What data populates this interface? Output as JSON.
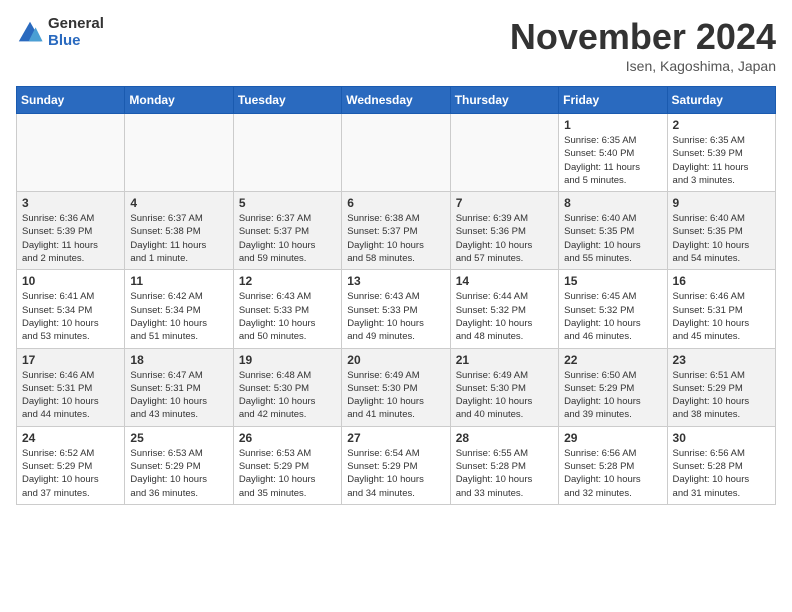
{
  "logo": {
    "general": "General",
    "blue": "Blue"
  },
  "title": "November 2024",
  "subtitle": "Isen, Kagoshima, Japan",
  "headers": [
    "Sunday",
    "Monday",
    "Tuesday",
    "Wednesday",
    "Thursday",
    "Friday",
    "Saturday"
  ],
  "weeks": [
    [
      {
        "day": "",
        "info": ""
      },
      {
        "day": "",
        "info": ""
      },
      {
        "day": "",
        "info": ""
      },
      {
        "day": "",
        "info": ""
      },
      {
        "day": "",
        "info": ""
      },
      {
        "day": "1",
        "info": "Sunrise: 6:35 AM\nSunset: 5:40 PM\nDaylight: 11 hours\nand 5 minutes."
      },
      {
        "day": "2",
        "info": "Sunrise: 6:35 AM\nSunset: 5:39 PM\nDaylight: 11 hours\nand 3 minutes."
      }
    ],
    [
      {
        "day": "3",
        "info": "Sunrise: 6:36 AM\nSunset: 5:39 PM\nDaylight: 11 hours\nand 2 minutes."
      },
      {
        "day": "4",
        "info": "Sunrise: 6:37 AM\nSunset: 5:38 PM\nDaylight: 11 hours\nand 1 minute."
      },
      {
        "day": "5",
        "info": "Sunrise: 6:37 AM\nSunset: 5:37 PM\nDaylight: 10 hours\nand 59 minutes."
      },
      {
        "day": "6",
        "info": "Sunrise: 6:38 AM\nSunset: 5:37 PM\nDaylight: 10 hours\nand 58 minutes."
      },
      {
        "day": "7",
        "info": "Sunrise: 6:39 AM\nSunset: 5:36 PM\nDaylight: 10 hours\nand 57 minutes."
      },
      {
        "day": "8",
        "info": "Sunrise: 6:40 AM\nSunset: 5:35 PM\nDaylight: 10 hours\nand 55 minutes."
      },
      {
        "day": "9",
        "info": "Sunrise: 6:40 AM\nSunset: 5:35 PM\nDaylight: 10 hours\nand 54 minutes."
      }
    ],
    [
      {
        "day": "10",
        "info": "Sunrise: 6:41 AM\nSunset: 5:34 PM\nDaylight: 10 hours\nand 53 minutes."
      },
      {
        "day": "11",
        "info": "Sunrise: 6:42 AM\nSunset: 5:34 PM\nDaylight: 10 hours\nand 51 minutes."
      },
      {
        "day": "12",
        "info": "Sunrise: 6:43 AM\nSunset: 5:33 PM\nDaylight: 10 hours\nand 50 minutes."
      },
      {
        "day": "13",
        "info": "Sunrise: 6:43 AM\nSunset: 5:33 PM\nDaylight: 10 hours\nand 49 minutes."
      },
      {
        "day": "14",
        "info": "Sunrise: 6:44 AM\nSunset: 5:32 PM\nDaylight: 10 hours\nand 48 minutes."
      },
      {
        "day": "15",
        "info": "Sunrise: 6:45 AM\nSunset: 5:32 PM\nDaylight: 10 hours\nand 46 minutes."
      },
      {
        "day": "16",
        "info": "Sunrise: 6:46 AM\nSunset: 5:31 PM\nDaylight: 10 hours\nand 45 minutes."
      }
    ],
    [
      {
        "day": "17",
        "info": "Sunrise: 6:46 AM\nSunset: 5:31 PM\nDaylight: 10 hours\nand 44 minutes."
      },
      {
        "day": "18",
        "info": "Sunrise: 6:47 AM\nSunset: 5:31 PM\nDaylight: 10 hours\nand 43 minutes."
      },
      {
        "day": "19",
        "info": "Sunrise: 6:48 AM\nSunset: 5:30 PM\nDaylight: 10 hours\nand 42 minutes."
      },
      {
        "day": "20",
        "info": "Sunrise: 6:49 AM\nSunset: 5:30 PM\nDaylight: 10 hours\nand 41 minutes."
      },
      {
        "day": "21",
        "info": "Sunrise: 6:49 AM\nSunset: 5:30 PM\nDaylight: 10 hours\nand 40 minutes."
      },
      {
        "day": "22",
        "info": "Sunrise: 6:50 AM\nSunset: 5:29 PM\nDaylight: 10 hours\nand 39 minutes."
      },
      {
        "day": "23",
        "info": "Sunrise: 6:51 AM\nSunset: 5:29 PM\nDaylight: 10 hours\nand 38 minutes."
      }
    ],
    [
      {
        "day": "24",
        "info": "Sunrise: 6:52 AM\nSunset: 5:29 PM\nDaylight: 10 hours\nand 37 minutes."
      },
      {
        "day": "25",
        "info": "Sunrise: 6:53 AM\nSunset: 5:29 PM\nDaylight: 10 hours\nand 36 minutes."
      },
      {
        "day": "26",
        "info": "Sunrise: 6:53 AM\nSunset: 5:29 PM\nDaylight: 10 hours\nand 35 minutes."
      },
      {
        "day": "27",
        "info": "Sunrise: 6:54 AM\nSunset: 5:29 PM\nDaylight: 10 hours\nand 34 minutes."
      },
      {
        "day": "28",
        "info": "Sunrise: 6:55 AM\nSunset: 5:28 PM\nDaylight: 10 hours\nand 33 minutes."
      },
      {
        "day": "29",
        "info": "Sunrise: 6:56 AM\nSunset: 5:28 PM\nDaylight: 10 hours\nand 32 minutes."
      },
      {
        "day": "30",
        "info": "Sunrise: 6:56 AM\nSunset: 5:28 PM\nDaylight: 10 hours\nand 31 minutes."
      }
    ]
  ]
}
